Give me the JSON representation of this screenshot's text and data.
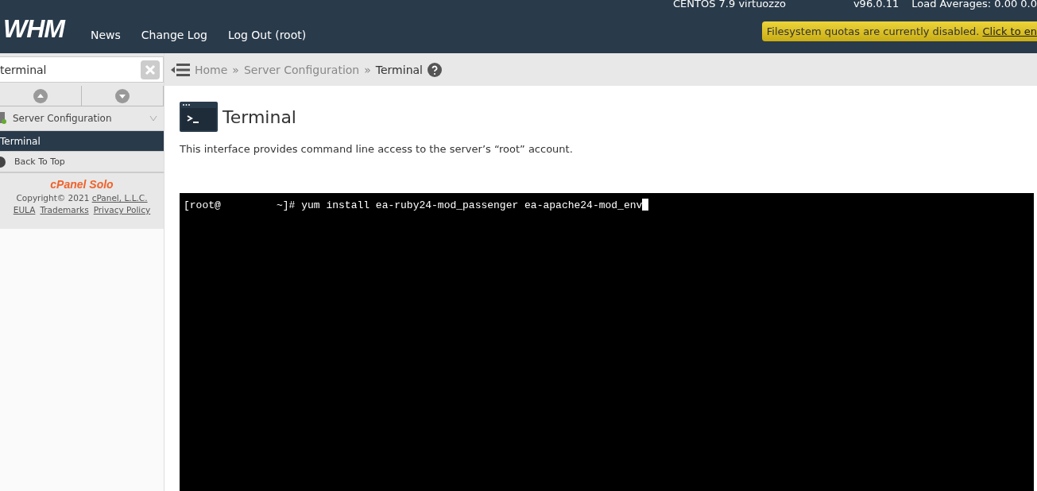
{
  "header": {
    "logo": "WHM",
    "nav": [
      "News",
      "Change Log",
      "Log Out (root)"
    ],
    "os": "CENTOS 7.9 virtuozzo",
    "version": "v96.0.11",
    "load": "Load Averages: 0.00 0.0",
    "alert": {
      "text": "Filesystem quotas are currently disabled.",
      "link": "Click to en"
    }
  },
  "sidebar": {
    "search": {
      "value": "terminal"
    },
    "category": "Server Configuration",
    "items": [
      {
        "label": "Terminal",
        "selected": true
      }
    ],
    "back": "Back To Top",
    "brand": "cPanel Solo",
    "copyright": "Copyright© 2021",
    "company": "cPanel, L.L.C.",
    "links": [
      "EULA",
      "Trademarks",
      "Privacy Policy"
    ]
  },
  "breadcrumb": {
    "separator": "»",
    "items": [
      "Home",
      "Server Configuration",
      "Terminal"
    ]
  },
  "page": {
    "title": "Terminal",
    "description": "This interface provides command line access to the server’s “root” account.",
    "terminal": {
      "prompt": "[root@         ~]#",
      "command": "yum install ea-ruby24-mod_passenger ea-apache24-mod_env"
    }
  }
}
